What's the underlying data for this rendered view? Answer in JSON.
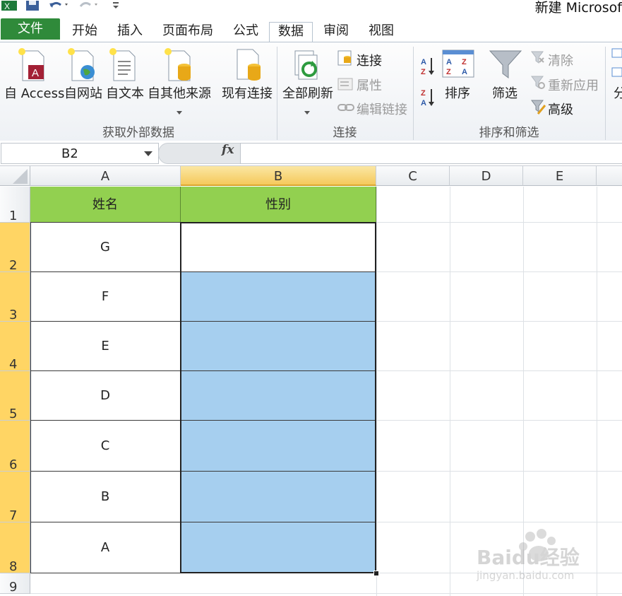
{
  "window": {
    "title": "新建 Microsof"
  },
  "tabs": [
    {
      "label": "文件"
    },
    {
      "label": "开始"
    },
    {
      "label": "插入"
    },
    {
      "label": "页面布局"
    },
    {
      "label": "公式"
    },
    {
      "label": "数据"
    },
    {
      "label": "审阅"
    },
    {
      "label": "视图"
    }
  ],
  "ribbon": {
    "external": {
      "access": "自 Access",
      "web": "自网站",
      "text": "自文本",
      "other": "自其他来源",
      "existing": "现有连接",
      "group_label": "获取外部数据"
    },
    "connections": {
      "refresh_all": "全部刷新",
      "connections": "连接",
      "properties": "属性",
      "edit_links": "编辑链接",
      "group_label": "连接"
    },
    "sort_filter": {
      "sort": "排序",
      "filter": "筛选",
      "clear": "清除",
      "reapply": "重新应用",
      "advanced": "高级",
      "group_label": "排序和筛选"
    },
    "overflow": "分"
  },
  "formula_bar": {
    "name_box": "B2",
    "fx": "fx",
    "formula": ""
  },
  "sheet": {
    "columns": [
      "A",
      "B",
      "C",
      "D",
      "E"
    ],
    "rows": [
      "1",
      "2",
      "3",
      "4",
      "5",
      "6",
      "7",
      "8",
      "9"
    ],
    "header_row": {
      "a": "姓名",
      "b": "性别"
    },
    "names": [
      "G",
      "F",
      "E",
      "D",
      "C",
      "B",
      "A"
    ],
    "colors": {
      "header_fill": "#92d050",
      "selection_fill": "#a6cfef",
      "row_header_sel": "#ffd564"
    }
  },
  "watermark": {
    "brand": "Baidu经验",
    "url": "jingyan.baidu.com"
  }
}
